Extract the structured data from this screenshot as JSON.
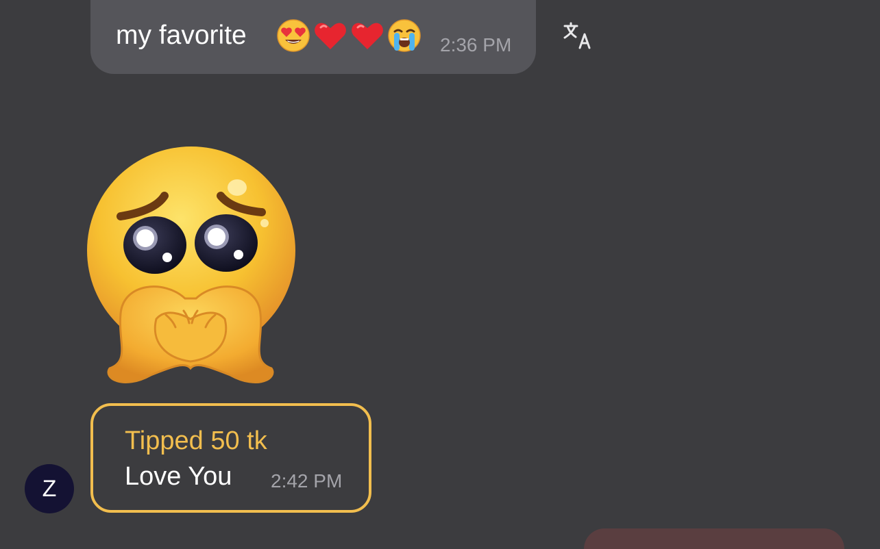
{
  "colors": {
    "background": "#3c3c3f",
    "bubble": "#55555a",
    "tip_accent": "#f2be4e",
    "timestamp": "#a4a4aa",
    "avatar_bg": "#141233"
  },
  "messages": [
    {
      "text": "my favorite",
      "emojis": [
        "heart-eyes-emoji",
        "red-heart-emoji",
        "red-heart-emoji",
        "loudly-crying-emoji"
      ],
      "time": "2:36 PM",
      "action_icon": "translate-icon"
    },
    {
      "type": "sticker",
      "sticker_name": "pleading-face-heart-hands-sticker"
    },
    {
      "type": "tip",
      "tip_label": "Tipped 50 tk",
      "text": "Love You",
      "time": "2:42 PM",
      "avatar_initial": "Z"
    }
  ]
}
